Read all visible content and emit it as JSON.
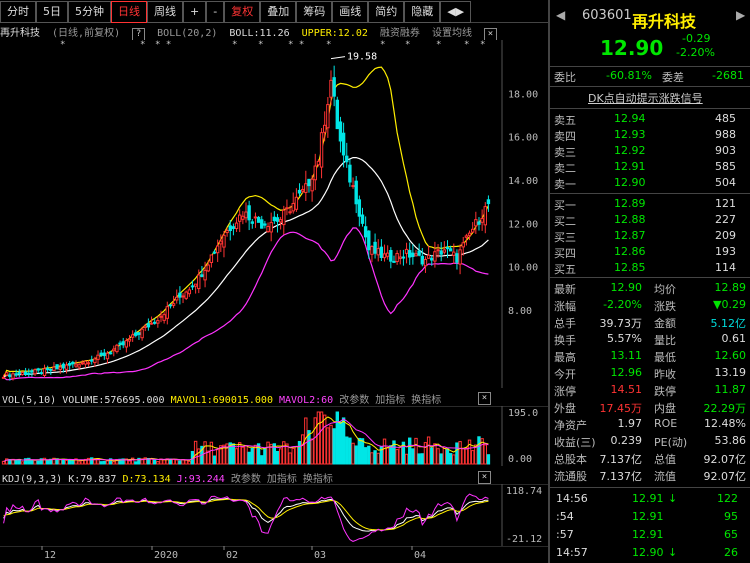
{
  "toolbar": {
    "tabs": [
      "分时",
      "5日",
      "5分钟",
      "日线",
      "周线",
      "+",
      "-",
      "复权",
      "叠加",
      "筹码",
      "画线",
      "简约",
      "隐藏"
    ],
    "active": "日线",
    "arrows": "◀▶"
  },
  "chart_header": {
    "title": "再升科技",
    "period": "(日线,前复权)",
    "boll_label": "BOLL(20,2)",
    "boll_value": "BOLL:11.26",
    "upper_value": "UPPER:12.02",
    "margin": "融资融券",
    "settings": "设置均线"
  },
  "main_axis": [
    "18.00",
    "16.00",
    "14.00",
    "12.00",
    "10.00",
    "8.00"
  ],
  "peak_label": "19.58",
  "vol_header": {
    "name": "VOL(5,10)",
    "volume": "VOLUME:576695.000",
    "mavol1": "MAVOL1:690015.000",
    "mavol2": "MAVOL2:60",
    "change_params": "改参数",
    "add_indicator": "加指标",
    "switch_indicator": "换指标"
  },
  "vol_axis": [
    "195.0",
    "0.00"
  ],
  "kdj_header": {
    "name": "KDJ(9,3,3)",
    "k": "K:79.837",
    "d": "D:73.134",
    "j": "J:93.244",
    "change_params": "改参数",
    "add_indicator": "加指标",
    "switch_indicator": "换指标"
  },
  "kdj_axis": [
    "118.74",
    "-21.12"
  ],
  "x_axis": [
    "12",
    "2020",
    "02",
    "03",
    "04"
  ],
  "quote": {
    "code": "603601",
    "name": "再升科技",
    "price": "12.90",
    "change": "-0.29",
    "change_pct": "-2.20%",
    "weibi_label": "委比",
    "weibi": "-60.81%",
    "weicha_label": "委差",
    "weicha": "-2681",
    "dk_title": "DK点自动提示涨跌信号",
    "sell": [
      {
        "label": "卖五",
        "price": "12.94",
        "vol": "485"
      },
      {
        "label": "卖四",
        "price": "12.93",
        "vol": "988"
      },
      {
        "label": "卖三",
        "price": "12.92",
        "vol": "903"
      },
      {
        "label": "卖二",
        "price": "12.91",
        "vol": "585"
      },
      {
        "label": "卖一",
        "price": "12.90",
        "vol": "504"
      }
    ],
    "buy": [
      {
        "label": "买一",
        "price": "12.89",
        "vol": "121"
      },
      {
        "label": "买二",
        "price": "12.88",
        "vol": "227"
      },
      {
        "label": "买三",
        "price": "12.87",
        "vol": "209"
      },
      {
        "label": "买四",
        "price": "12.86",
        "vol": "193"
      },
      {
        "label": "买五",
        "price": "12.85",
        "vol": "114"
      }
    ],
    "stats": [
      {
        "l1": "最新",
        "v1": "12.90",
        "c1": "green",
        "l2": "均价",
        "v2": "12.89",
        "c2": "green"
      },
      {
        "l1": "涨幅",
        "v1": "-2.20%",
        "c1": "green",
        "l2": "涨跌",
        "v2": "▼0.29",
        "c2": "green"
      },
      {
        "l1": "总手",
        "v1": "39.73万",
        "c1": "white",
        "l2": "金额",
        "v2": "5.12亿",
        "c2": "cyan"
      },
      {
        "l1": "换手",
        "v1": "5.57%",
        "c1": "white",
        "l2": "量比",
        "v2": "0.61",
        "c2": "white"
      },
      {
        "l1": "最高",
        "v1": "13.11",
        "c1": "green",
        "l2": "最低",
        "v2": "12.60",
        "c2": "green"
      },
      {
        "l1": "今开",
        "v1": "12.96",
        "c1": "green",
        "l2": "昨收",
        "v2": "13.19",
        "c2": "white"
      },
      {
        "l1": "涨停",
        "v1": "14.51",
        "c1": "red",
        "l2": "跌停",
        "v2": "11.87",
        "c2": "green"
      },
      {
        "l1": "外盘",
        "v1": "17.45万",
        "c1": "red",
        "l2": "内盘",
        "v2": "22.29万",
        "c2": "green"
      },
      {
        "l1": "净资产",
        "v1": "1.97",
        "c1": "white",
        "l2": "ROE",
        "v2": "12.48%",
        "c2": "white"
      },
      {
        "l1": "收益(三)",
        "v1": "0.239",
        "c1": "white",
        "l2": "PE(动)",
        "v2": "53.86",
        "c2": "white"
      },
      {
        "l1": "总股本",
        "v1": "7.137亿",
        "c1": "white",
        "l2": "总值",
        "v2": "92.07亿",
        "c2": "white"
      },
      {
        "l1": "流通股",
        "v1": "7.137亿",
        "c1": "white",
        "l2": "流值",
        "v2": "92.07亿",
        "c2": "white"
      }
    ],
    "ticks": [
      {
        "time": "14:56",
        "price": "12.91",
        "arrow": "↓",
        "vol": "122"
      },
      {
        "time": ":54",
        "price": "12.91",
        "arrow": "",
        "vol": "95"
      },
      {
        "time": ":57",
        "price": "12.91",
        "arrow": "",
        "vol": "65"
      },
      {
        "time": "14:57",
        "price": "12.90",
        "arrow": "↓",
        "vol": "26"
      }
    ]
  },
  "colors": {
    "up": "#ff3333",
    "down": "#00e6e6",
    "mid": "#ffffff",
    "upper": "#ffee00",
    "lower": "#ff33ff",
    "kline": "#ffffff",
    "dline": "#ffee00",
    "jline": "#ff33ff"
  }
}
